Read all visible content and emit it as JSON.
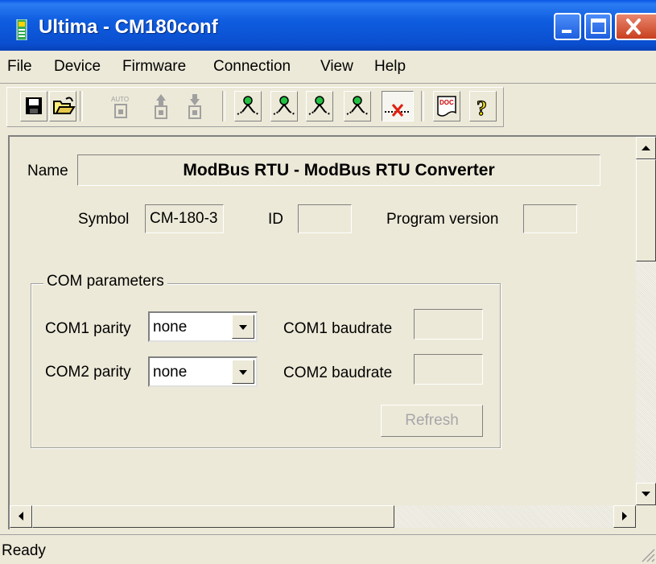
{
  "window": {
    "title": "Ultima - CM180conf"
  },
  "menu": [
    "File",
    "Device",
    "Firmware",
    "Connection",
    "View",
    "Help"
  ],
  "toolbar": {
    "buttons": [
      "save-icon",
      "open-folder-icon",
      "auto-icon",
      "upload-icon",
      "download-icon",
      "connect-1-icon",
      "connect-2-icon",
      "connect-3-icon",
      "connect-4-icon",
      "disconnect-icon",
      "doc-icon",
      "help-icon"
    ],
    "auto_text": "AUTO",
    "doc_text": "DOC",
    "help_glyph": "?"
  },
  "device": {
    "name_label": "Name",
    "name_value": "ModBus RTU - ModBus RTU Converter",
    "symbol_label": "Symbol",
    "symbol_value": "CM-180-3",
    "id_label": "ID",
    "id_value": "",
    "program_version_label": "Program version",
    "program_version_value": ""
  },
  "com": {
    "group_title": "COM parameters",
    "com1_parity_label": "COM1 parity",
    "com1_parity_value": "none",
    "com1_baud_label": "COM1 baudrate",
    "com1_baud_value": "",
    "com2_parity_label": "COM2 parity",
    "com2_parity_value": "none",
    "com2_baud_label": "COM2 baudrate",
    "com2_baud_value": "",
    "refresh_label": "Refresh"
  },
  "status": {
    "text": "Ready"
  },
  "colors": {
    "titlebar": "#0a4fd0",
    "close": "#c83f1f",
    "background": "#ece9d8"
  }
}
